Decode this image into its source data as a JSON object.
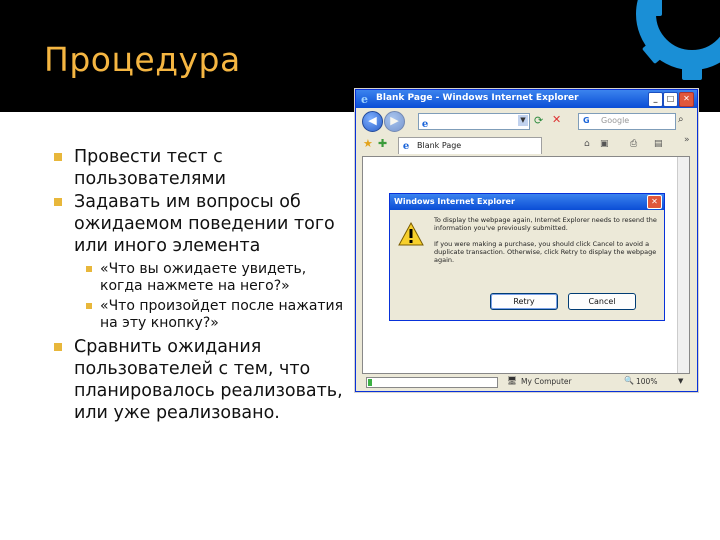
{
  "slide": {
    "title": "Процедура",
    "bullets": [
      {
        "text": "Провести тест с пользователями"
      },
      {
        "text": "Задавать им вопросы об ожидаемом поведении того или иного элемента",
        "sub": [
          "«Что вы ожидаете увидеть, когда нажмете на него?»",
          "«Что произойдет после нажатия на эту кнопку?»"
        ]
      },
      {
        "text": "Сравнить ожидания пользователей с тем, что планировалось реализовать, или уже реализовано."
      }
    ],
    "colors": {
      "background": "#000000",
      "title": "#f5b642",
      "bullet_marker": "#e8b73b",
      "band": "#ffffff"
    },
    "decor_icon": "gear-icon"
  },
  "browser": {
    "window_title": "Blank Page - Windows Internet Explorer",
    "address_value": "",
    "search_placeholder": "Google",
    "tab_label": "Blank Page",
    "toolbar_overflow": "»",
    "dialog": {
      "title": "Windows Internet Explorer",
      "message_1": "To display the webpage again, Internet Explorer needs to resend the information you've previously submitted.",
      "message_2": "If you were making a purchase, you should click Cancel to avoid a duplicate transaction. Otherwise, click Retry to display the webpage again.",
      "retry_label": "Retry",
      "cancel_label": "Cancel",
      "icon": "warning-icon"
    },
    "status": {
      "zone": "My Computer",
      "zoom": "100%",
      "progress_fraction": 0.03
    }
  }
}
